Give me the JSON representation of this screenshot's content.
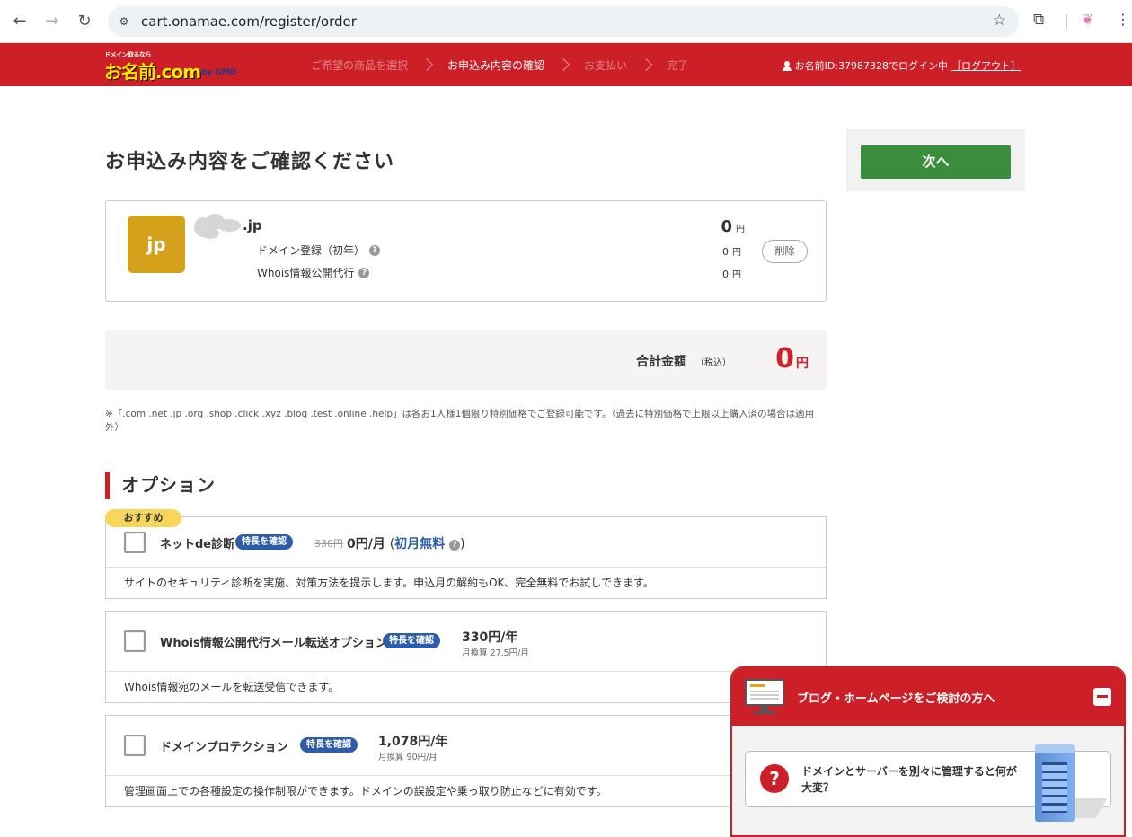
{
  "browser": {
    "url": "cart.onamae.com/register/order"
  },
  "header": {
    "logo_tagline": "ドメイン取るなら",
    "logo_text": "お名前.com",
    "logo_gmo": "by GMO",
    "steps": [
      {
        "label": "ご希望の商品を選択",
        "active": false
      },
      {
        "label": "お申込み内容の確認",
        "active": true
      },
      {
        "label": "お支払い",
        "active": false
      },
      {
        "label": "完了",
        "active": false
      }
    ],
    "login_text": "お名前ID:37987328でログイン中",
    "logout_label": "［ログアウト］"
  },
  "main": {
    "title": "お申込み内容をご確認ください",
    "order_item": {
      "tld_badge": "jp",
      "domain_suffix": ".jp",
      "total_price": "0",
      "currency": "円",
      "lines": [
        {
          "label": "ドメイン登録（初年）",
          "price": "0"
        },
        {
          "label": "Whois情報公開代行",
          "price": "0"
        }
      ],
      "delete_label": "削除"
    },
    "total": {
      "label": "合計金額",
      "tax_note": "（税込）",
      "value": "0",
      "currency": "円"
    },
    "note": "※「.com .net .jp .org .shop .click .xyz .blog .test .online .help」は各お1人様1個限り特別価格でご登録可能です。（過去に特別価格で上限以上購入済の場合は適用外）",
    "options_heading": "オプション",
    "options": [
      {
        "recommend_badge": "おすすめ",
        "name": "ネットde診断",
        "feature_tag": "特長を確認",
        "original_price": "330円",
        "price": "0円/月",
        "price_paren_open": "(",
        "free_label": "初月無料",
        "price_paren_close": ")",
        "description": "サイトのセキュリティ診断を実施、対策方法を提示します。申込月の解約もOK、完全無料でお試しできます。"
      },
      {
        "name": "Whois情報公開代行メール転送オプション",
        "feature_tag": "特長を確認",
        "price": "330円/年",
        "sub_price": "月換算 27.5円/月",
        "description": "Whois情報宛のメールを転送受信できます。"
      },
      {
        "name": "ドメインプロテクション",
        "feature_tag": "特長を確認",
        "price": "1,078円/年",
        "sub_price": "月換算 90円/月",
        "description": "管理画面上での各種設定の操作制限ができます。ドメインの誤設定や乗っ取り防止などに有効です。"
      }
    ]
  },
  "sidebar": {
    "next_label": "次へ"
  },
  "float_panel": {
    "title": "ブログ・ホームページをご検討の方へ",
    "faq_mark": "?",
    "faq_text": "ドメインとサーバーを別々に管理すると何が大変？"
  },
  "colors": {
    "brand_red": "#cc1f27",
    "next_green": "#3a8d3a",
    "price_red": "#d0202c",
    "tag_blue": "#2d5ca8",
    "tld_gold": "#d4a11b"
  }
}
